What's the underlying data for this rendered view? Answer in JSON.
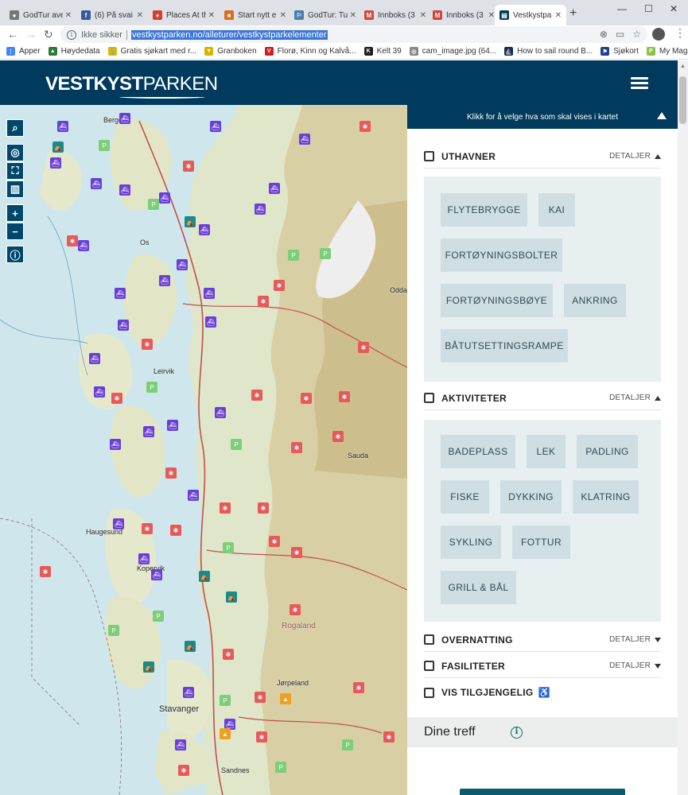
{
  "browser": {
    "tabs": [
      {
        "title": "GodTur ave",
        "color": "#777777",
        "glyph": "●"
      },
      {
        "title": "(6) På svai",
        "color": "#3b5998",
        "glyph": "f"
      },
      {
        "title": "Places At th",
        "color": "#d23f31",
        "glyph": "♦"
      },
      {
        "title": "Start nytt e",
        "color": "#e06a1b",
        "glyph": "■"
      },
      {
        "title": "GodTur: Tu",
        "color": "#4a7bb0",
        "glyph": "⚐"
      },
      {
        "title": "Innboks (3",
        "color": "#d44638",
        "glyph": "M"
      },
      {
        "title": "Innboks (3",
        "color": "#d44638",
        "glyph": "M"
      },
      {
        "title": "Vestkystpa",
        "color": "#003a5c",
        "glyph": "▤"
      }
    ],
    "security_label": "Ikke sikker",
    "url": "vestkystparken.no/alleturer/vestkystparkelementer",
    "bookmarks": [
      {
        "label": "Apper",
        "color": "#4285f4",
        "glyph": "⋮"
      },
      {
        "label": "Høydedata",
        "color": "#2a7b3a",
        "glyph": "▲"
      },
      {
        "label": "Gratis sjøkart med r...",
        "color": "#e0b400",
        "glyph": "⚓"
      },
      {
        "label": "Granboken",
        "color": "#d6b500",
        "glyph": "▼"
      },
      {
        "label": "Florø, Kinn og Kalvå...",
        "color": "#d02020",
        "glyph": "V"
      },
      {
        "label": "Kelt 39",
        "color": "#222222",
        "glyph": "K"
      },
      {
        "label": "cam_image.jpg (64...",
        "color": "#888888",
        "glyph": "◎"
      },
      {
        "label": "How to sail round B...",
        "color": "#003366",
        "glyph": "⛵"
      },
      {
        "label": "Sjøkort",
        "color": "#1f3f8f",
        "glyph": "⚑"
      },
      {
        "label": "My Magazines",
        "color": "#8bc34a",
        "glyph": "P"
      }
    ]
  },
  "site": {
    "logo_bold": "VESTKYST",
    "logo_light": "PARKEN"
  },
  "map": {
    "labels": [
      {
        "text": "Bergen",
        "cls": ""
      },
      {
        "text": "Os",
        "cls": ""
      },
      {
        "text": "Leirvik",
        "cls": ""
      },
      {
        "text": "Haugesund",
        "cls": ""
      },
      {
        "text": "Kopervik",
        "cls": ""
      },
      {
        "text": "Sauda",
        "cls": ""
      },
      {
        "text": "Odda",
        "cls": ""
      },
      {
        "text": "Rogaland",
        "cls": "big"
      },
      {
        "text": "Jørpeland",
        "cls": ""
      },
      {
        "text": "Stavanger",
        "cls": ""
      },
      {
        "text": "Sandnes",
        "cls": ""
      }
    ]
  },
  "panel": {
    "header": "Klikk for å velge hva som skal vises i kartet",
    "details_label": "DETALJER",
    "sections": {
      "uthavner": {
        "title": "UTHAVNER",
        "chips": [
          "FLYTEBRYGGE",
          "KAI",
          "FORTØYNINGSBOLTER",
          "FORTØYNINGSBØYE",
          "ANKRING",
          "BÅTUTSETTINGSRAMPE"
        ]
      },
      "aktiviteter": {
        "title": "AKTIVITETER",
        "chips": [
          "BADEPLASS",
          "LEK",
          "PADLING",
          "FISKE",
          "DYKKING",
          "KLATRING",
          "SYKLING",
          "FOTTUR",
          "GRILL & BÅL"
        ]
      },
      "overnatting": {
        "title": "OVERNATTING"
      },
      "fasiliteter": {
        "title": "FASILITETER"
      },
      "tilgjengelig": {
        "title": "VIS TILGJENGELIG"
      }
    },
    "results_title": "Dine treff"
  }
}
